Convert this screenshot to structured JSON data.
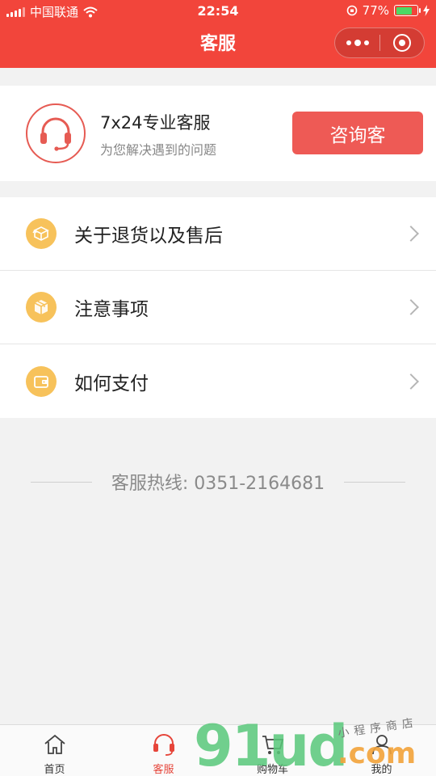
{
  "status_bar": {
    "carrier": "中国联通",
    "time": "22:54",
    "battery": "77%",
    "battery_level": 0.77
  },
  "nav": {
    "title": "客服"
  },
  "service": {
    "title": "7x24专业客服",
    "subtitle": "为您解决遇到的问题",
    "button": "咨询客"
  },
  "menu": {
    "items": [
      {
        "label": "关于退货以及售后",
        "icon": "package-return-icon"
      },
      {
        "label": "注意事项",
        "icon": "box-icon"
      },
      {
        "label": "如何支付",
        "icon": "wallet-icon"
      }
    ]
  },
  "hotline": {
    "text": "客服热线: 0351-2164681"
  },
  "tabbar": {
    "items": [
      {
        "label": "首页",
        "icon": "home-icon",
        "active": false
      },
      {
        "label": "客服",
        "icon": "headset-icon",
        "active": true
      },
      {
        "label": "购物车",
        "icon": "cart-icon",
        "active": false
      },
      {
        "label": "我的",
        "icon": "user-icon",
        "active": false
      }
    ]
  },
  "watermark": {
    "brand": "91ud",
    "domain": ".com",
    "tagline": "小程序商店"
  },
  "colors": {
    "primary": "#f2453b",
    "button": "#ee5a55",
    "menu_icon": "#f7c25b",
    "watermark_green": "#59c87a",
    "watermark_orange": "#f3a33a"
  }
}
